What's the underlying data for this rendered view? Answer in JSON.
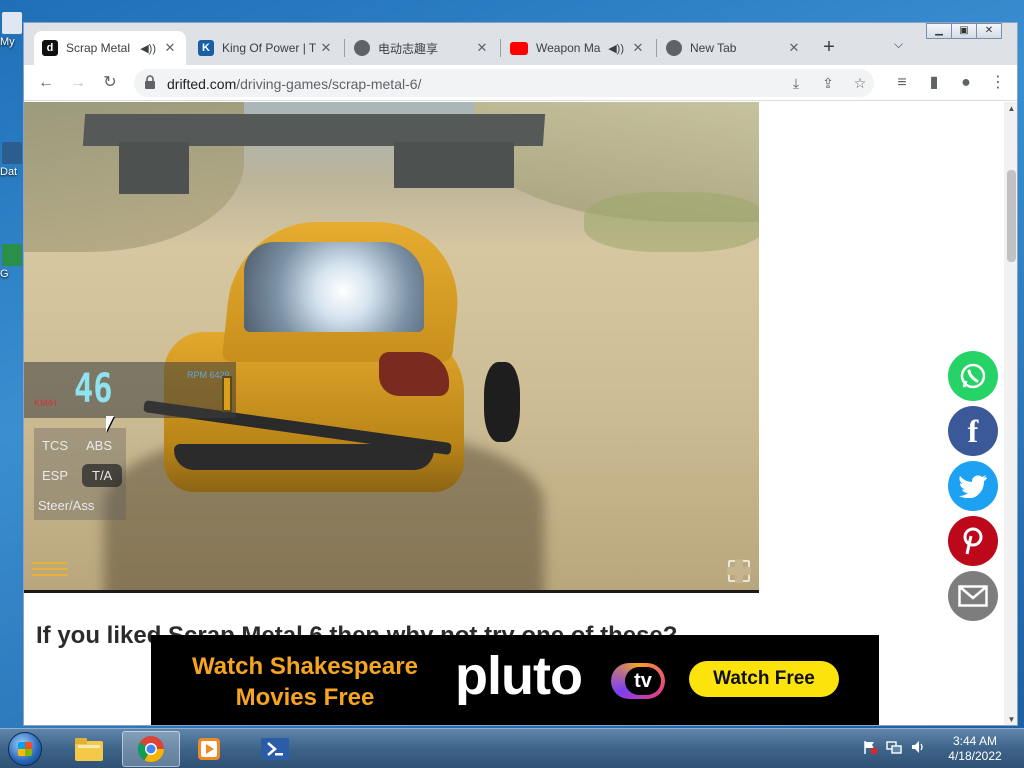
{
  "desktop": {
    "icons": [
      {
        "label": "My"
      },
      {
        "label": "Dat"
      },
      {
        "label": "G"
      }
    ]
  },
  "browser": {
    "tabs": [
      {
        "title": "Scrap Metal",
        "favicon_letter": "d",
        "favicon_color": "#111111",
        "audio": true,
        "active": true
      },
      {
        "title": "King Of Power | T",
        "favicon_letter": "K",
        "favicon_color": "#1a5fa3",
        "audio": false,
        "active": false
      },
      {
        "title": "电动志趣享",
        "favicon_letter": "",
        "favicon_color": "#5f6368",
        "audio": false,
        "active": false
      },
      {
        "title": "Weapon Ma",
        "favicon_letter": "",
        "favicon_color": "#ff0000",
        "audio": true,
        "active": false
      },
      {
        "title": "New Tab",
        "favicon_letter": "",
        "favicon_color": "#5f6368",
        "audio": false,
        "active": false
      }
    ],
    "url_host": "drifted.com",
    "url_path": "/driving-games/scrap-metal-6/"
  },
  "game": {
    "speed": "46",
    "speed_unit": "KM/H",
    "rpm_label": "RPM 6429",
    "assists": {
      "tcs": "TCS",
      "abs": "ABS",
      "esp": "ESP",
      "ta": "T/A",
      "steer": "Steer/Ass"
    }
  },
  "page": {
    "related_heading": "If you liked Scrap Metal 6 then why not try one of these?"
  },
  "ad": {
    "headline_line1": "Watch Shakespeare",
    "headline_line2": "Movies Free",
    "brand": "pluto",
    "brand_tv": "tv",
    "cta": "Watch Free"
  },
  "social_colors": {
    "whatsapp": "#25d366",
    "facebook": "#3b5998",
    "twitter": "#1da1f2",
    "pinterest": "#bd081c",
    "email": "#7d7d7d"
  },
  "taskbar": {
    "time": "3:44 AM",
    "date": "4/18/2022"
  }
}
